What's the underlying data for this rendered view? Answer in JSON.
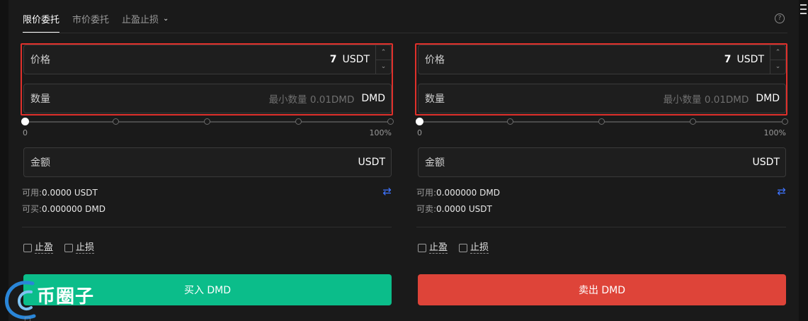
{
  "tabs": [
    {
      "label": "限价委托"
    },
    {
      "label": "市价委托"
    },
    {
      "label": "止盈止损"
    }
  ],
  "help_icon": "question-circle-icon",
  "buy": {
    "price_label": "价格",
    "price_value": "7",
    "price_unit": "USDT",
    "qty_label": "数量",
    "qty_placeholder": "最小数量 0.01DMD",
    "qty_unit": "DMD",
    "slider_min": "0",
    "slider_max": "100%",
    "slider_value": 0,
    "amount_label": "金额",
    "amount_unit": "USDT",
    "available_label": "可用:",
    "available_value": "0.0000 USDT",
    "buyable_label": "可买:",
    "buyable_value": "0.000000 DMD",
    "tp_label": "止盈",
    "sl_label": "止损",
    "button_label": "买入 DMD",
    "button_color": "#0bbd8a"
  },
  "sell": {
    "price_label": "价格",
    "price_value": "7",
    "price_unit": "USDT",
    "qty_label": "数量",
    "qty_placeholder": "最小数量 0.01DMD",
    "qty_unit": "DMD",
    "slider_min": "0",
    "slider_max": "100%",
    "slider_value": 0,
    "amount_label": "金额",
    "amount_unit": "USDT",
    "available_label": "可用:",
    "available_value": "0.000000 DMD",
    "sellable_label": "可卖:",
    "sellable_value": "0.0000 USDT",
    "tp_label": "止盈",
    "sl_label": "止损",
    "button_label": "卖出 DMD",
    "button_color": "#de4439"
  },
  "watermark": {
    "text": "币圈子"
  },
  "colors": {
    "highlight": "#e0302b",
    "accent": "#3f74ff"
  }
}
